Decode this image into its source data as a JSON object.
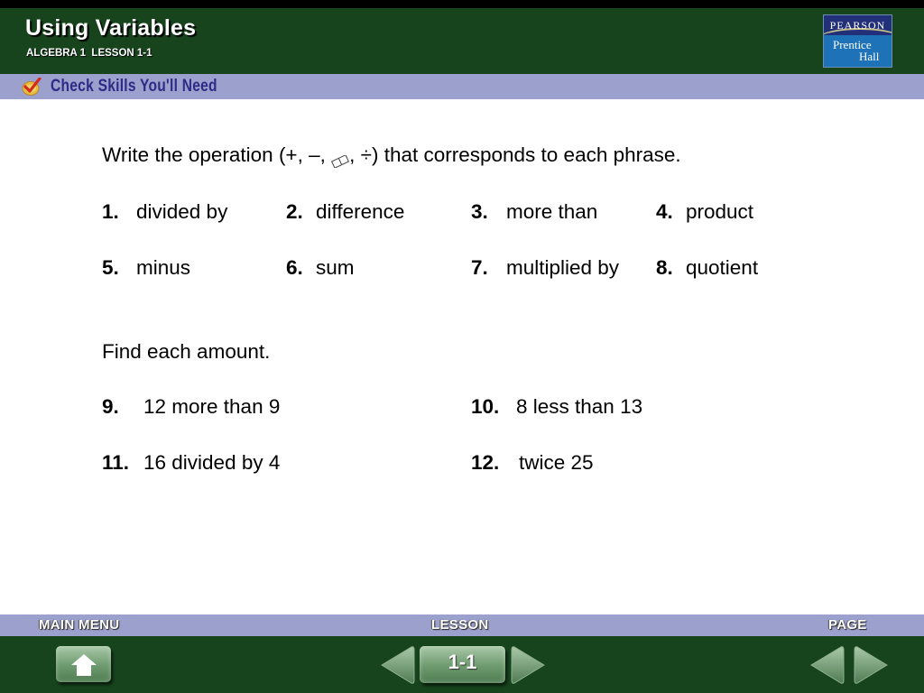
{
  "header": {
    "title": "Using Variables",
    "subtitle": "ALGEBRA 1  LESSON 1-1",
    "logo": {
      "line1": "PEARSON",
      "line2": "Prentice",
      "line3": "Hall"
    }
  },
  "skills_bar": {
    "icon": "check-icon",
    "label": "Check Skills You'll Need"
  },
  "content": {
    "instruction1_pre": "Write the operation (+, –, ",
    "instruction1_symbol": "multiplication-symbol (rendered as missing glyph)",
    "instruction1_post": ", ÷) that corresponds to each phrase.",
    "phrases": [
      {
        "num": "1.",
        "text": "divided by"
      },
      {
        "num": "2.",
        "text": "difference"
      },
      {
        "num": "3.",
        "text": "more than"
      },
      {
        "num": "4.",
        "text": "product"
      },
      {
        "num": "5.",
        "text": "minus"
      },
      {
        "num": "6.",
        "text": "sum"
      },
      {
        "num": "7.",
        "text": "multiplied by"
      },
      {
        "num": "8.",
        "text": "quotient"
      }
    ],
    "instruction2": "Find each amount.",
    "amounts": [
      {
        "num": "9.",
        "text": "12 more than 9"
      },
      {
        "num": "10.",
        "text": "8 less than 13"
      },
      {
        "num": "11.",
        "text": "16 divided by 4"
      },
      {
        "num": "12.",
        "text": "twice 25"
      }
    ]
  },
  "nav": {
    "main_menu_label": "MAIN MENU",
    "lesson_label": "LESSON",
    "page_label": "PAGE",
    "lesson_number": "1-1",
    "icons": {
      "home": "home-arrow-icon",
      "lesson_prev": "triangle-left-icon",
      "lesson_next": "triangle-right-icon",
      "page_prev": "triangle-left-icon",
      "page_next": "triangle-right-icon"
    }
  },
  "colors": {
    "header_green": "#17441d",
    "bar_lavender": "#9ba0cc",
    "skills_text": "#2e2a86",
    "button_green": "#6d9a6e"
  }
}
